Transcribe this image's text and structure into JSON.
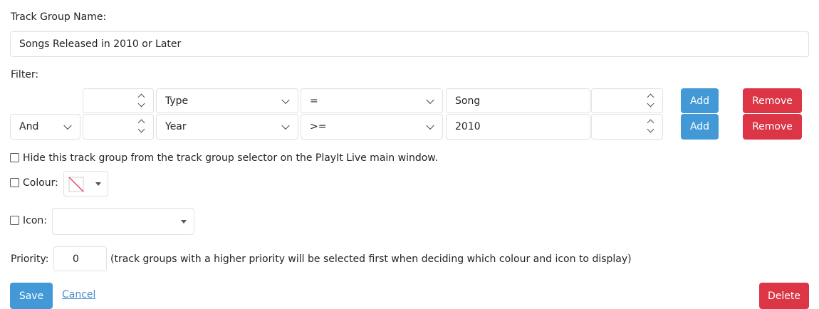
{
  "labels": {
    "name_label": "Track Group Name:",
    "filter_label": "Filter:",
    "hide_label": "Hide this track group from the track group selector on the PlayIt Live main window.",
    "colour_label": "Colour:",
    "icon_label": "Icon:",
    "priority_label": "Priority:",
    "priority_hint": "(track groups with a higher priority will be selected first when deciding which colour and icon to display)"
  },
  "name_input": {
    "value": "Songs Released in 2010 or Later"
  },
  "filters": [
    {
      "conjunction": "",
      "field": "Type",
      "operator": "=",
      "value": "Song",
      "add_label": "Add",
      "remove_label": "Remove"
    },
    {
      "conjunction": "And",
      "field": "Year",
      "operator": ">=",
      "value": "2010",
      "add_label": "Add",
      "remove_label": "Remove"
    }
  ],
  "options": {
    "hide_checked": false,
    "colour_checked": false,
    "icon_checked": false,
    "icon_value": "",
    "priority_value": "0"
  },
  "actions": {
    "save_label": "Save",
    "cancel_label": "Cancel",
    "delete_label": "Delete"
  },
  "colors": {
    "primary": "#4299d6",
    "danger": "#dc3545",
    "link": "#4a8fc9"
  }
}
